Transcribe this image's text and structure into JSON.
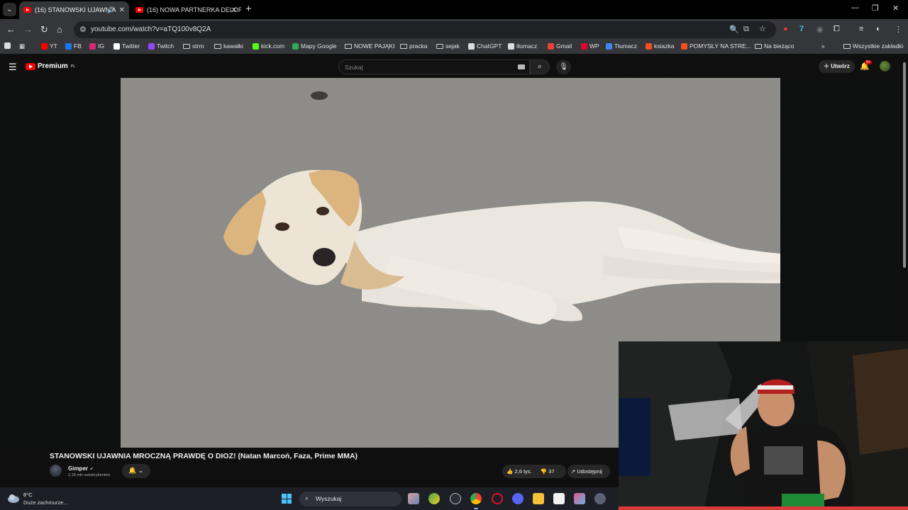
{
  "browser": {
    "tabs": [
      {
        "title": "(16) STANOWSKI UJAWNIA",
        "active": true
      },
      {
        "title": "(16) NOWA PARTNERKA DELOR",
        "active": false
      }
    ],
    "url": "youtube.com/watch?v=aTQ100v8Q2A",
    "bookmarks": [
      {
        "label": "YT",
        "icon": "youtube-icon",
        "color": "#ff0000"
      },
      {
        "label": "FB",
        "icon": "facebook-icon",
        "color": "#1877f2"
      },
      {
        "label": "IG",
        "icon": "instagram-icon",
        "color": "#d62976"
      },
      {
        "label": "Twitter",
        "icon": "x-icon",
        "color": "#ffffff"
      },
      {
        "label": "Twitch",
        "icon": "twitch-icon",
        "color": "#9146ff"
      },
      {
        "label": "strm",
        "icon": "folder-icon"
      },
      {
        "label": "kawałki",
        "icon": "folder-icon"
      },
      {
        "label": "kick.com",
        "icon": "kick-icon",
        "color": "#53fc18"
      },
      {
        "label": "Mapy Google",
        "icon": "maps-icon",
        "color": "#34a853"
      },
      {
        "label": "NOWE PAJĄKI",
        "icon": "folder-icon"
      },
      {
        "label": "pracka",
        "icon": "folder-icon"
      },
      {
        "label": "sejak",
        "icon": "folder-icon"
      },
      {
        "label": "ChatGPT",
        "icon": "chatgpt-icon",
        "color": "#dddddd"
      },
      {
        "label": "tłumacz",
        "icon": "globe-icon",
        "color": "#dddddd"
      },
      {
        "label": "Gmail",
        "icon": "gmail-icon",
        "color": "#ea4335"
      },
      {
        "label": "WP",
        "icon": "wp-icon",
        "color": "#e4002b"
      },
      {
        "label": "Tłumacz",
        "icon": "translate-icon",
        "color": "#4285f4"
      },
      {
        "label": "ksiazka",
        "icon": "windows-icon",
        "color": "#f25022"
      },
      {
        "label": "POMYSŁY NA STRE...",
        "icon": "windows-icon",
        "color": "#f25022"
      },
      {
        "label": "Na bieżąco",
        "icon": "folder-icon"
      }
    ],
    "all_bookmarks": "Wszystkie zakładki"
  },
  "youtube": {
    "logo_text": "Premium",
    "logo_sup": "PL",
    "search_placeholder": "Szukaj",
    "create_label": "Utwórz",
    "notif_badge": "9+",
    "video_title": "STANOWSKI UJAWNIA MROCZNĄ PRAWDĘ O DIOZ! (Natan Marcoń, Faza, Prime MMA)",
    "channel_name": "Gimper",
    "channel_verified": "✔",
    "subscribers": "2,18 mln subskrybentów",
    "likes": "2,6 tys.",
    "dislikes": "37",
    "share_label": "Udostępnij"
  },
  "taskbar": {
    "temperature": "6°C",
    "weather": "Duże zachmurze...",
    "search_label": "Wyszukaj"
  },
  "colors": {
    "accent_red": "#ff0000",
    "windows_blue": "#4cc2ff"
  }
}
